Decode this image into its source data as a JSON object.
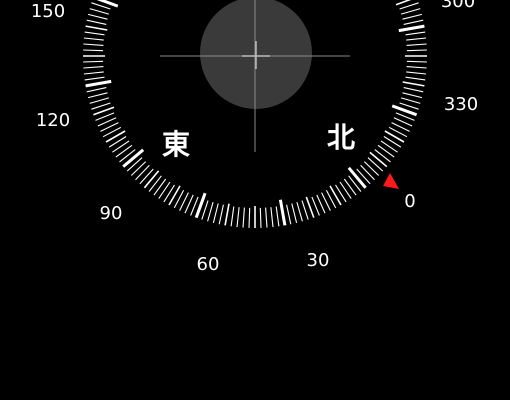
{
  "compass": {
    "degree_labels": [
      "0",
      "30",
      "60",
      "90",
      "120",
      "150",
      "300",
      "330"
    ],
    "direction_labels": {
      "north": "北",
      "east": "東"
    },
    "heading_marker_color": "#ff1a1a",
    "tick_color": "#ffffff",
    "level_bubble_color": "#3a3a3a"
  }
}
